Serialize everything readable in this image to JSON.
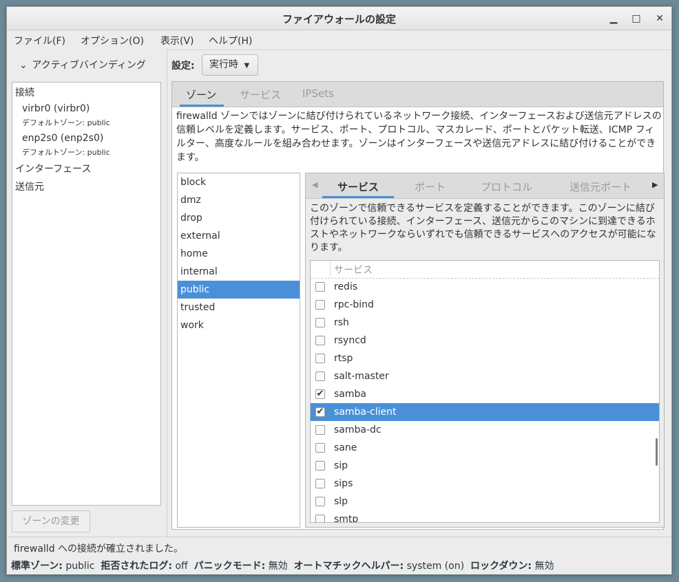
{
  "window": {
    "title": "ファイアウォールの設定",
    "minimize_icon": "minimize-icon",
    "maximize_icon": "maximize-icon",
    "close_icon": "close-icon"
  },
  "menubar": {
    "file": "ファイル(F)",
    "options": "オプション(O)",
    "view": "表示(V)",
    "help": "ヘルプ(H)"
  },
  "left": {
    "header": "アクティブバインディング",
    "connections_label": "接続",
    "connections": [
      {
        "name": "virbr0 (virbr0)",
        "zone": "デフォルトゾーン: public"
      },
      {
        "name": "enp2s0 (enp2s0)",
        "zone": "デフォルトゾーン: public"
      }
    ],
    "interfaces_label": "インターフェース",
    "sources_label": "送信元",
    "change_zone_button": "ゾーンの変更"
  },
  "settings": {
    "label": "設定:",
    "mode": "実行時"
  },
  "outer_tabs": [
    "ゾーン",
    "サービス",
    "IPSets"
  ],
  "zone_description": "firewalld ゾーンではゾーンに結び付けられているネットワーク接続、インターフェースおよび送信元アドレスの信頼レベルを定義します。サービス、ポート、プロトコル、マスカレード、ポートとパケット転送、ICMP フィルター、高度なルールを組み合わせます。ゾーンはインターフェースや送信元アドレスに結び付けることができます。",
  "zones": [
    "block",
    "dmz",
    "drop",
    "external",
    "home",
    "internal",
    "public",
    "trusted",
    "work"
  ],
  "selected_zone": "public",
  "inner_tabs": [
    "サービス",
    "ポート",
    "プロトコル",
    "送信元ポート"
  ],
  "service_description": "このゾーンで信頼できるサービスを定義することができます。このゾーンに結び付けられている接続、インターフェース、送信元からこのマシンに到達できるホストやネットワークならいずれでも信頼できるサービスへのアクセスが可能になります。",
  "services_header": "サービス",
  "services": [
    {
      "name": "redis",
      "checked": false
    },
    {
      "name": "rpc-bind",
      "checked": false
    },
    {
      "name": "rsh",
      "checked": false
    },
    {
      "name": "rsyncd",
      "checked": false
    },
    {
      "name": "rtsp",
      "checked": false
    },
    {
      "name": "salt-master",
      "checked": false
    },
    {
      "name": "samba",
      "checked": true
    },
    {
      "name": "samba-client",
      "checked": true,
      "selected": true
    },
    {
      "name": "samba-dc",
      "checked": false
    },
    {
      "name": "sane",
      "checked": false
    },
    {
      "name": "sip",
      "checked": false
    },
    {
      "name": "sips",
      "checked": false
    },
    {
      "name": "slp",
      "checked": false
    },
    {
      "name": "smtp",
      "checked": false
    }
  ],
  "status": {
    "message": "firewalld への接続が確立されました。",
    "default_zone_label": "標準ゾーン:",
    "default_zone_value": "public",
    "denied_log_label": "拒否されたログ:",
    "denied_log_value": "off",
    "panic_label": "パニックモード:",
    "panic_value": "無効",
    "helper_label": "オートマチックヘルパー:",
    "helper_value": "system (on)",
    "lockdown_label": "ロックダウン:",
    "lockdown_value": "無効"
  },
  "colors": {
    "accent": "#4a90d9",
    "window_bg": "#ececec"
  }
}
